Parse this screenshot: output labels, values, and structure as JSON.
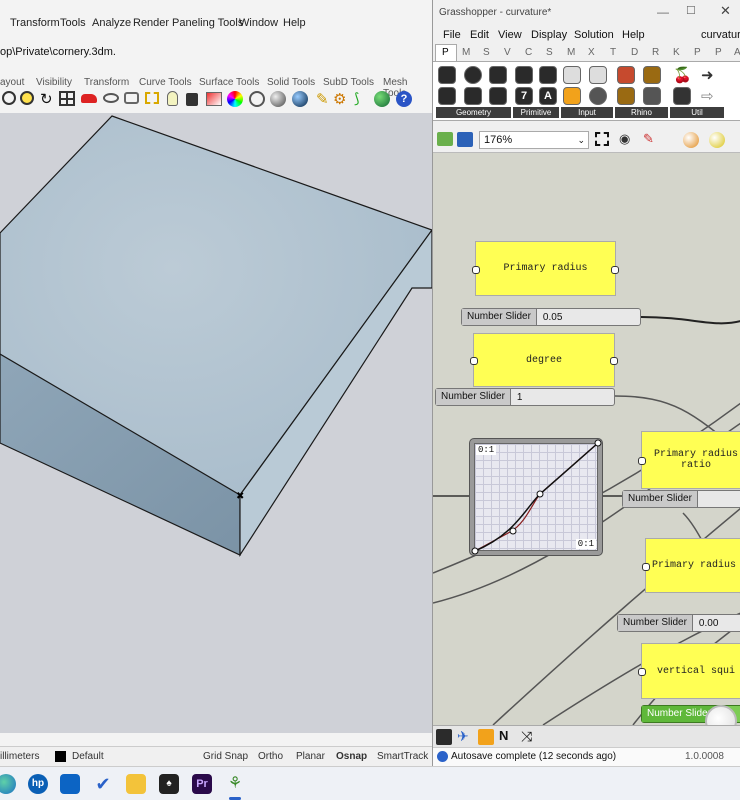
{
  "rhino": {
    "menu": [
      "Transform",
      "Tools",
      "Analyze",
      "Render",
      "Paneling Tools",
      "Window",
      "Help"
    ],
    "path": "op\\Private\\cornery.3dm.",
    "tabs": [
      "ayout",
      "Visibility",
      "Transform",
      "Curve Tools",
      "Surface Tools",
      "Solid Tools",
      "SubD Tools",
      "Mesh Tools"
    ],
    "toolbar_icons": [
      "zoom-icon",
      "zoom-window-icon",
      "rotate-icon",
      "grid-icon",
      "car-icon",
      "eye-icon",
      "camera-icon",
      "dimension-icon",
      "bulb-icon",
      "lock-icon",
      "paint-icon",
      "color-wheel-icon",
      "sphere-icon",
      "sphere-shaded-icon",
      "pen-icon",
      "gear-icon",
      "script-icon",
      "globe-icon",
      "help-icon"
    ],
    "status": {
      "units": "illimeters",
      "layer": "Default",
      "grid_snap": "Grid Snap",
      "ortho": "Ortho",
      "planar": "Planar",
      "osnap": "Osnap",
      "smarttrack": "SmartTrack"
    }
  },
  "grasshopper": {
    "title": "Grasshopper - curvature*",
    "menu": [
      "File",
      "Edit",
      "View",
      "Display",
      "Solution",
      "Help"
    ],
    "doc_name": "curvature",
    "tabs": [
      "P",
      "M",
      "S",
      "V",
      "C",
      "S",
      "M",
      "X",
      "T",
      "D",
      "R",
      "K",
      "P",
      "P",
      "A"
    ],
    "groups": [
      "Geometry",
      "Primitive",
      "Input",
      "Rhino",
      "Util"
    ],
    "zoom": "176%",
    "panels": {
      "primary_radius": "Primary radius",
      "degree": "degree",
      "primary_radius_ratio": "Primary radius ratio",
      "primary_radius_p": "Primary radius p",
      "vertical_squi": "vertical squi"
    },
    "sliders": {
      "s1_label": "Number Slider",
      "s1_value": "0.05",
      "s2_label": "Number Slider",
      "s2_value": "1",
      "s3_label": "Number Slider",
      "s3_value": "",
      "s4_label": "Number Slider",
      "s4_value": "0.00",
      "s5_label": "Number Slider",
      "s5_value": ""
    },
    "graph": {
      "top_label": "0:1",
      "bottom_label": "0:1"
    },
    "status": {
      "autosave": "Autosave complete (12 seconds ago)",
      "version": "1.0.0008"
    }
  },
  "taskbar": {
    "icons": [
      "edge-icon",
      "hp-icon",
      "outlook-icon",
      "todo-icon",
      "folder-icon",
      "solitaire-icon",
      "premiere-icon",
      "grasshopper-icon"
    ],
    "premiere_label": "Pr"
  }
}
